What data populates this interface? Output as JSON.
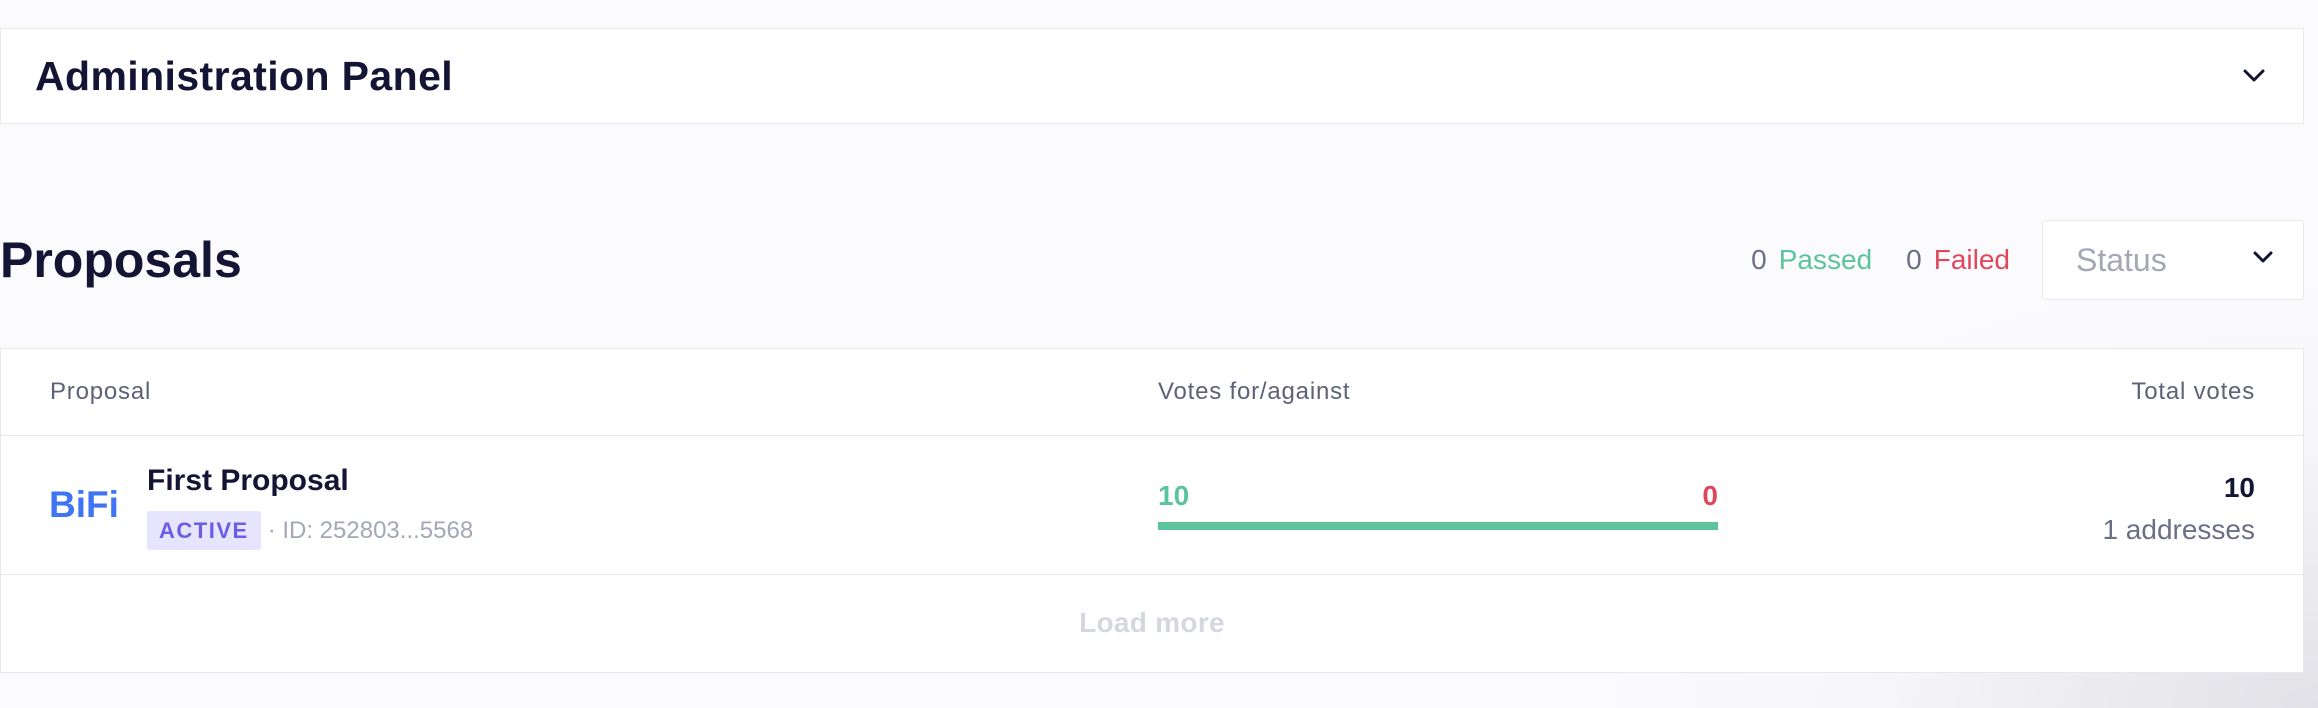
{
  "admin_panel": {
    "title": "Administration Panel"
  },
  "proposals": {
    "title": "Proposals",
    "passed_count": "0",
    "passed_label": "Passed",
    "failed_count": "0",
    "failed_label": "Failed",
    "status_placeholder": "Status"
  },
  "table": {
    "columns": [
      "Proposal",
      "Votes for/against",
      "Total votes"
    ],
    "rows": [
      {
        "logo_text": "BiFi",
        "name": "First Proposal",
        "status": "ACTIVE",
        "id_text": "· ID: 252803...5568",
        "votes_for": "10",
        "votes_against": "0",
        "for_fraction": 1.0,
        "total_votes": "10",
        "addresses": "1 addresses"
      }
    ],
    "load_more_label": "Load more"
  },
  "colors": {
    "passed": "#5cc49d",
    "failed": "#e1475b",
    "badge_bg": "#e7e4fd",
    "badge_text": "#6c5ce6",
    "logo": "#3f74f4"
  },
  "icons": {
    "admin_toggle": "chevron-down-icon",
    "status_toggle": "chevron-down-icon"
  }
}
